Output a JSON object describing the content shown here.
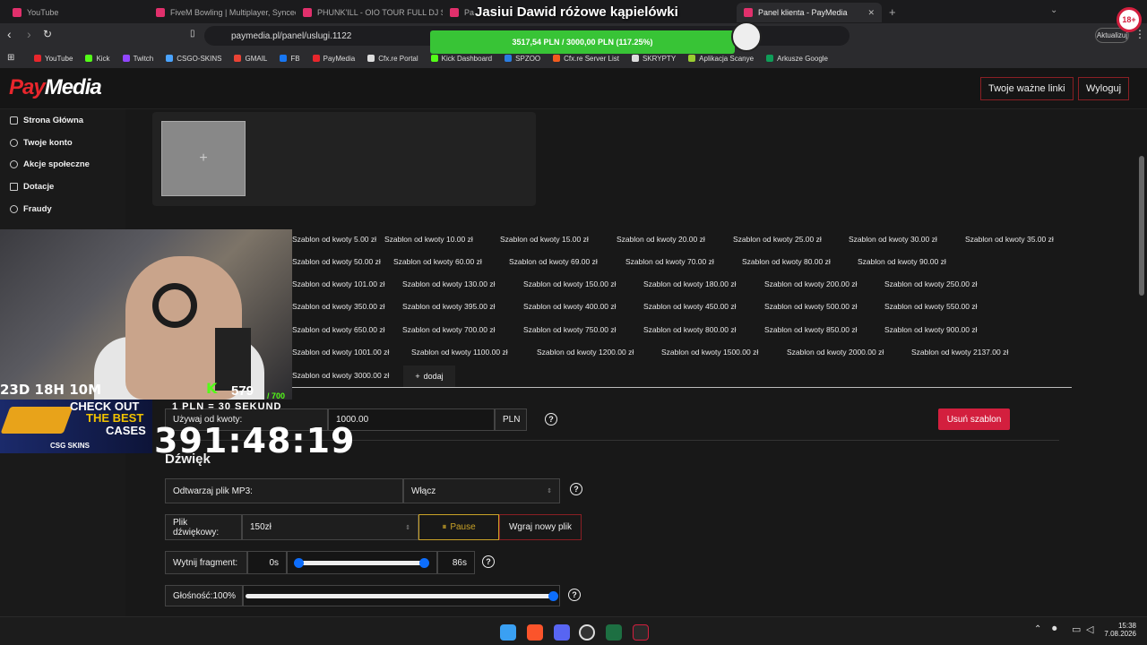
{
  "browser": {
    "tabs": [
      {
        "label": "YouTube"
      },
      {
        "label": "FiveM Bowling | Multiplayer, Synced,"
      },
      {
        "label": "PHUNK'ILL - OIO TOUR FULL DJ SET"
      },
      {
        "label": "Pa"
      },
      {
        "label": "Panel klienta - PayMedia",
        "active": true
      }
    ],
    "url": "paymedia.pl/panel/uslugi.1122",
    "update_button": "Aktualizuj",
    "bookmarks": [
      "YouTube",
      "Kick",
      "Twitch",
      "CSGO-SKINS",
      "GMAIL",
      "FB",
      "PayMedia",
      "Cfx.re Portal",
      "Kick Dashboard",
      "SPZOO",
      "Cfx.re Server List",
      "SKRYPTY",
      "Aplikacja Scanye",
      "Arkusze Google"
    ]
  },
  "stream_overlay": {
    "goal_title": "Jasiui Dawid różowe kąpielówki",
    "goal_text": "3517,54 PLN / 3000,00 PLN  (117.25%)",
    "goal_progress": 1.0,
    "kick_count": "579",
    "kick_goal": "/ 700",
    "rate": "1 PLN = 30 SEKUND",
    "countdown": "23D 18H 10M",
    "promo_line1": "CHECK OUT",
    "promo_line2": "THE BEST",
    "promo_line3": "CASES",
    "promo_brand": "CSG SKINS",
    "timer": "391:48:19"
  },
  "site": {
    "logo_part1": "Pay",
    "logo_part2": "Media",
    "header_buttons": [
      "Twoje ważne linki",
      "Wyloguj"
    ],
    "sidebar": [
      {
        "label": "Strona Główna",
        "icon": "home-icon"
      },
      {
        "label": "Twoje konto",
        "icon": "user-icon"
      },
      {
        "label": "Akcje społeczne",
        "icon": "heart-icon"
      },
      {
        "label": "Dotacje",
        "icon": "document-icon"
      },
      {
        "label": "Fraudy",
        "icon": "x-circle-icon"
      }
    ],
    "add_image_symbol": "+",
    "templates": [
      [
        "Szablon od kwoty 5.00 zł",
        "Szablon od kwoty 10.00 zł",
        "Szablon od kwoty 15.00 zł",
        "Szablon od kwoty 20.00 zł",
        "Szablon od kwoty 25.00 zł",
        "Szablon od kwoty 30.00 zł",
        "Szablon od kwoty 35.00 zł"
      ],
      [
        "Szablon od kwoty 50.00 zł",
        "Szablon od kwoty 60.00 zł",
        "Szablon od kwoty 69.00 zł",
        "Szablon od kwoty 70.00 zł",
        "Szablon od kwoty 80.00 zł",
        "Szablon od kwoty 90.00 zł"
      ],
      [
        "Szablon od kwoty 101.00 zł",
        "Szablon od kwoty 130.00 zł",
        "Szablon od kwoty 150.00 zł",
        "Szablon od kwoty 180.00 zł",
        "Szablon od kwoty 200.00 zł",
        "Szablon od kwoty 250.00 zł"
      ],
      [
        "Szablon od kwoty 350.00 zł",
        "Szablon od kwoty 395.00 zł",
        "Szablon od kwoty 400.00 zł",
        "Szablon od kwoty 450.00 zł",
        "Szablon od kwoty 500.00 zł",
        "Szablon od kwoty 550.00 zł"
      ],
      [
        "Szablon od kwoty 650.00 zł",
        "Szablon od kwoty 700.00 zł",
        "Szablon od kwoty 750.00 zł",
        "Szablon od kwoty 800.00 zł",
        "Szablon od kwoty 850.00 zł",
        "Szablon od kwoty 900.00 zł"
      ],
      [
        "Szablon od kwoty 1001.00 zł",
        "Szablon od kwoty 1100.00 zł",
        "Szablon od kwoty 1200.00 zł",
        "Szablon od kwoty 1500.00 zł",
        "Szablon od kwoty 2000.00 zł",
        "Szablon od kwoty 2137.00 zł"
      ],
      [
        "Szablon od kwoty 3000.00 zł"
      ]
    ],
    "add_template_label": "dodaj",
    "use_from_label": "Używaj od kwoty:",
    "use_from_value": "1000.00",
    "currency": "PLN",
    "delete_template": "Usuń szablon",
    "sound_heading": "Dźwięk",
    "play_mp3_label": "Odtwarzaj plik MP3:",
    "play_mp3_value": "Włącz",
    "sound_file_label": "Plik dźwiękowy:",
    "sound_file_value": "150zł",
    "pause_label": "Pause",
    "upload_label": "Wgraj nowy plik",
    "trim_label": "Wytnij fragment:",
    "trim_start": "0s",
    "trim_end": "86s",
    "trim_range": [
      0,
      86
    ],
    "volume_label": "Głośność:100%",
    "volume": 1.0,
    "help_symbol": "?"
  },
  "taskbar": {
    "time": "15:38",
    "date": "7.08.2026"
  },
  "colors": {
    "accent": "#e8262c",
    "danger": "#d31f3e",
    "goal": "#38c436",
    "slider": "#0d6efd"
  }
}
